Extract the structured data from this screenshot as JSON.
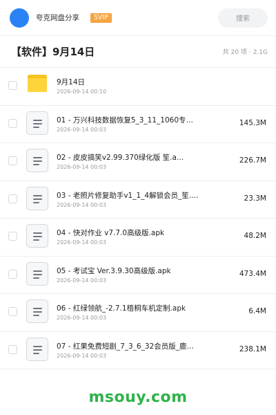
{
  "header": {
    "brand": "夸克网盘分享",
    "badge": "SVIP",
    "search_label": "搜索"
  },
  "folder": {
    "title": "【软件】9月14日",
    "count": "共 20 项",
    "size": "2.1G"
  },
  "files": [
    {
      "name": "9月14日",
      "date": "2026-09-14 00:10",
      "size": "",
      "icon": "folder-icon"
    },
    {
      "name": "01 - 万兴科技数据恢复5_3_11_1060专…",
      "date": "2026-09-14 00:03",
      "size": "145.3M",
      "icon": "document-icon"
    },
    {
      "name": "02 - 皮皮搞笑v2.99.370绿化版 笙.a…",
      "date": "2026-09-14 00:03",
      "size": "226.7M",
      "icon": "document-icon"
    },
    {
      "name": "03 - 老照片修复助手v1_1_4解锁会员_笙.…",
      "date": "2026-09-14 00:03",
      "size": "23.3M",
      "icon": "document-icon"
    },
    {
      "name": "04 - 快对作业 v7.7.0高级版.apk",
      "date": "2026-09-14 00:03",
      "size": "48.2M",
      "icon": "document-icon"
    },
    {
      "name": "05 - 考试宝 Ver.3.9.30高级版.apk",
      "date": "2026-09-14 00:03",
      "size": "473.4M",
      "icon": "document-icon"
    },
    {
      "name": "06 - 红绿领航_-2.7.1梧桐车机定制.apk",
      "date": "2026-09-14 00:03",
      "size": "6.4M",
      "icon": "document-icon"
    },
    {
      "name": "07 - 红果免费短剧_7_3_6_32会员版_鹿…",
      "date": "2026-09-14 00:03",
      "size": "238.1M",
      "icon": "document-icon"
    }
  ],
  "watermark": "msouy.com",
  "colors": {
    "accent": "#2a83f5",
    "badge": "#f5a443",
    "folder": "#ffd43b",
    "watermark": "#2fb24a"
  }
}
